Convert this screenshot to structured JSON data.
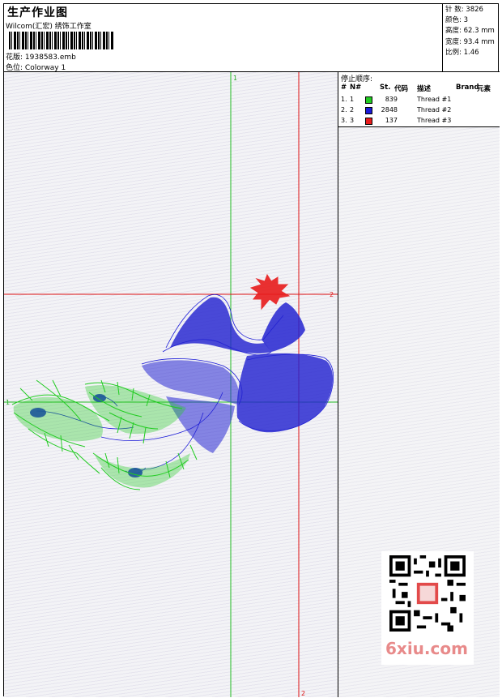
{
  "header": {
    "title": "生产作业图",
    "subtitle": "Wilcom(汇宏) 绣饰工作室",
    "file_label": "花版:",
    "file_name": "1938583.emb",
    "colorway_label": "色位:",
    "colorway_name": "Colorway 1"
  },
  "stats": {
    "stitches_label": "针 数:",
    "stitches": "3826",
    "colors_label": "颜色:",
    "colors": "3",
    "height_label": "高度:",
    "height": "62.3 mm",
    "width_label": "宽度:",
    "width": "93.4 mm",
    "scale_label": "比例:",
    "scale": "1.46"
  },
  "stop_sequence": {
    "heading": "停止顺序:",
    "columns": [
      "#",
      "N#",
      "St.",
      "代码",
      "描述",
      "Brand",
      "元素"
    ],
    "rows": [
      {
        "idx": "1.",
        "n": "1",
        "color": "#22cc22",
        "stitches": "839",
        "desc": "Thread #1"
      },
      {
        "idx": "2.",
        "n": "2",
        "color": "#1a1ad8",
        "stitches": "2848",
        "desc": "Thread #2"
      },
      {
        "idx": "3.",
        "n": "3",
        "color": "#e81c1c",
        "stitches": "137",
        "desc": "Thread #3"
      }
    ]
  },
  "axes": {
    "v1": "1",
    "h1": "1",
    "v2": "2",
    "h2": "2"
  },
  "watermark": {
    "text": "6xiu.com"
  },
  "colors": {
    "axis1": "#22bb22",
    "axis2": "#dd1111",
    "thread1": "#22cc22",
    "thread2": "#1a1ad8",
    "thread3": "#e81c1c"
  }
}
